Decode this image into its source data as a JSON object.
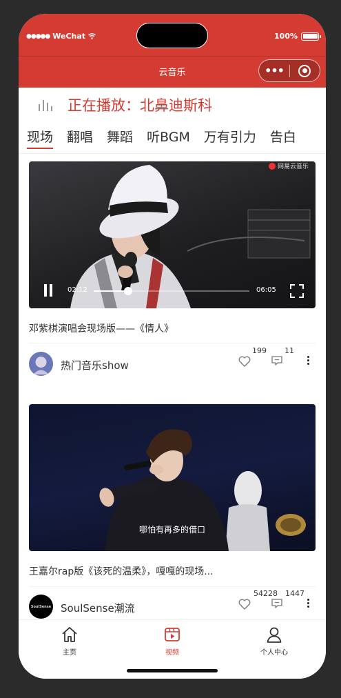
{
  "status_bar": {
    "carrier": "WeChat",
    "signal_dots": "●●●●●",
    "battery": "100%"
  },
  "app": {
    "title": "云音乐",
    "capsule_more": "•••"
  },
  "now_playing": {
    "label": "正在播放：北鼻迪斯科"
  },
  "tabs": [
    {
      "label": "现场",
      "active": true
    },
    {
      "label": "翻唱",
      "active": false
    },
    {
      "label": "舞蹈",
      "active": false
    },
    {
      "label": "听BGM",
      "active": false
    },
    {
      "label": "万有引力",
      "active": false
    },
    {
      "label": "告白",
      "active": false
    }
  ],
  "videos": [
    {
      "title": "邓紫棋演唱会现场版——《情人》",
      "author": "热门音乐show",
      "likes": "199",
      "comments": "11",
      "watermark": "网易云音乐",
      "player": {
        "current_time": "02:12",
        "duration": "06:05",
        "progress": 0.22,
        "state": "playing"
      }
    },
    {
      "title": "王嘉尔rap版《该死的温柔》，嘎嘎的现场...",
      "author": "SoulSense潮流",
      "likes": "54228",
      "comments": "1447",
      "subtitle": "哪怕有再多的借口",
      "avatar_text": "SoulSense"
    }
  ],
  "bottom_nav": [
    {
      "label": "主页",
      "icon": "home-icon",
      "active": false
    },
    {
      "label": "视频",
      "icon": "video-icon",
      "active": true
    },
    {
      "label": "个人中心",
      "icon": "person-icon",
      "active": false
    }
  ],
  "colors": {
    "brand": "#d43c33",
    "text": "#333333",
    "background": "#ffffff"
  }
}
